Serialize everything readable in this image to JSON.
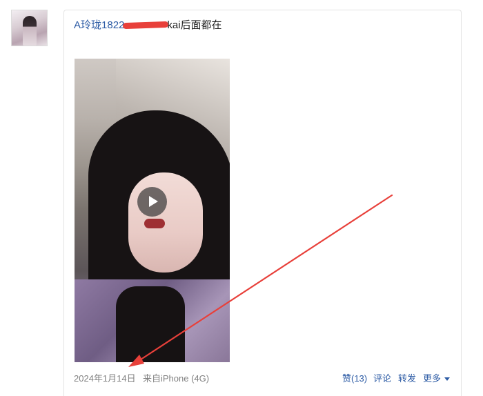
{
  "post": {
    "username": "A玲珑1822",
    "text_after_redaction": "kai后面都在",
    "date": "2024年1月14日",
    "source": "来自iPhone (4G)"
  },
  "actions": {
    "like": "赞(13)",
    "comment": "评论",
    "repost": "转发",
    "more": "更多"
  },
  "colors": {
    "link": "#2b5aa4",
    "meta_text": "#808080",
    "annotation_red": "#e8403a"
  },
  "icons": {
    "play": "play-icon",
    "more": "caret-down-icon"
  }
}
